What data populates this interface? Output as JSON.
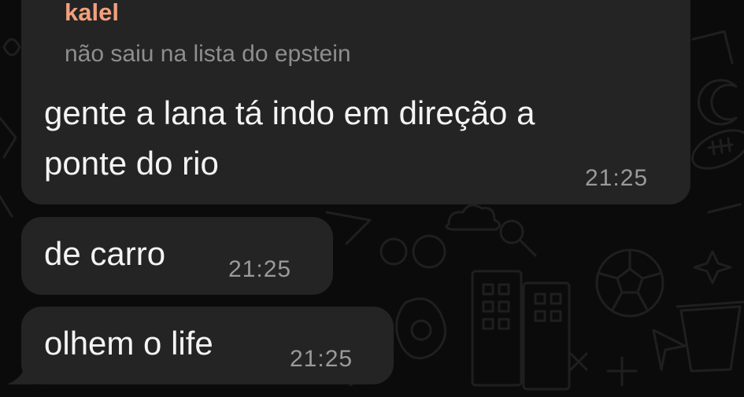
{
  "chat": {
    "background_color": "#0b0b0b",
    "bubble_color": "#242424",
    "sender_color": "#f2a07d",
    "messages": [
      {
        "sender": "kalel",
        "reply_preview": "não saiu na lista do epstein",
        "lines": [
          "gente a lana tá indo em direção a",
          "ponte do rio"
        ],
        "time": "21:25"
      },
      {
        "lines": [
          "de carro"
        ],
        "time": "21:25"
      },
      {
        "lines": [
          "olhem o life"
        ],
        "time": "21:25"
      }
    ]
  },
  "icons": {
    "background": "doodle-wallpaper"
  }
}
